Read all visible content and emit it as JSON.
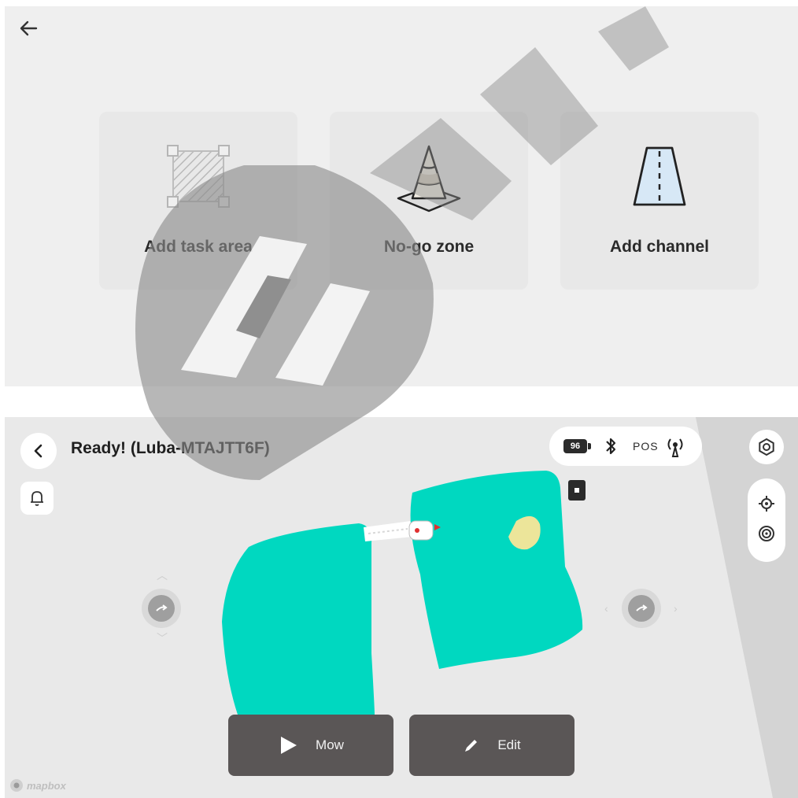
{
  "setup_screen": {
    "back_icon": "arrow-left-icon",
    "options": [
      {
        "label": "Add task area",
        "icon": "task-area-icon"
      },
      {
        "label": "No-go zone",
        "icon": "traffic-cone-icon"
      },
      {
        "label": "Add channel",
        "icon": "channel-icon"
      }
    ]
  },
  "map_screen": {
    "title": "Ready! (Luba-MTAJTT6F)",
    "status": {
      "battery": "96",
      "bluetooth_icon": "bluetooth-icon",
      "pos_label": "POS",
      "pos_icon": "rtk-signal-icon"
    },
    "buttons": {
      "mow_label": "Mow",
      "edit_label": "Edit"
    },
    "attribution": "mapbox",
    "colors": {
      "zone": "#00d8c0",
      "no_go": "#ece59a",
      "button_bg": "#5a5656",
      "map_bg": "#e9e9e9"
    }
  }
}
